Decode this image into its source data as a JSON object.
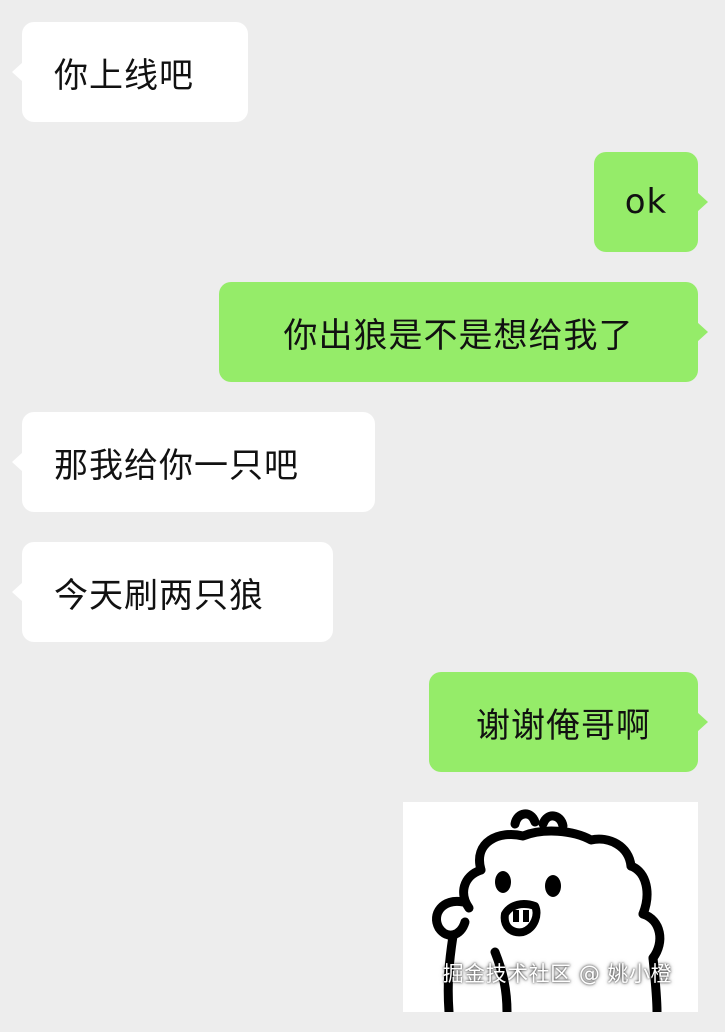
{
  "colors": {
    "background": "#ededed",
    "incoming_bubble": "#ffffff",
    "outgoing_bubble": "#95ec69",
    "text": "#111111"
  },
  "messages": [
    {
      "side": "incoming",
      "text": "你上线吧"
    },
    {
      "side": "outgoing",
      "text": "ok"
    },
    {
      "side": "outgoing",
      "text": "你出狼是不是想给我了"
    },
    {
      "side": "incoming",
      "text": "那我给你一只吧"
    },
    {
      "side": "incoming",
      "text": "今天刷两只狼"
    },
    {
      "side": "outgoing",
      "text": "谢谢俺哥啊"
    }
  ],
  "sticker": {
    "icon": "doodle-cat-sticker-icon",
    "watermark": "掘金技术社区 @ 姚小橙"
  }
}
